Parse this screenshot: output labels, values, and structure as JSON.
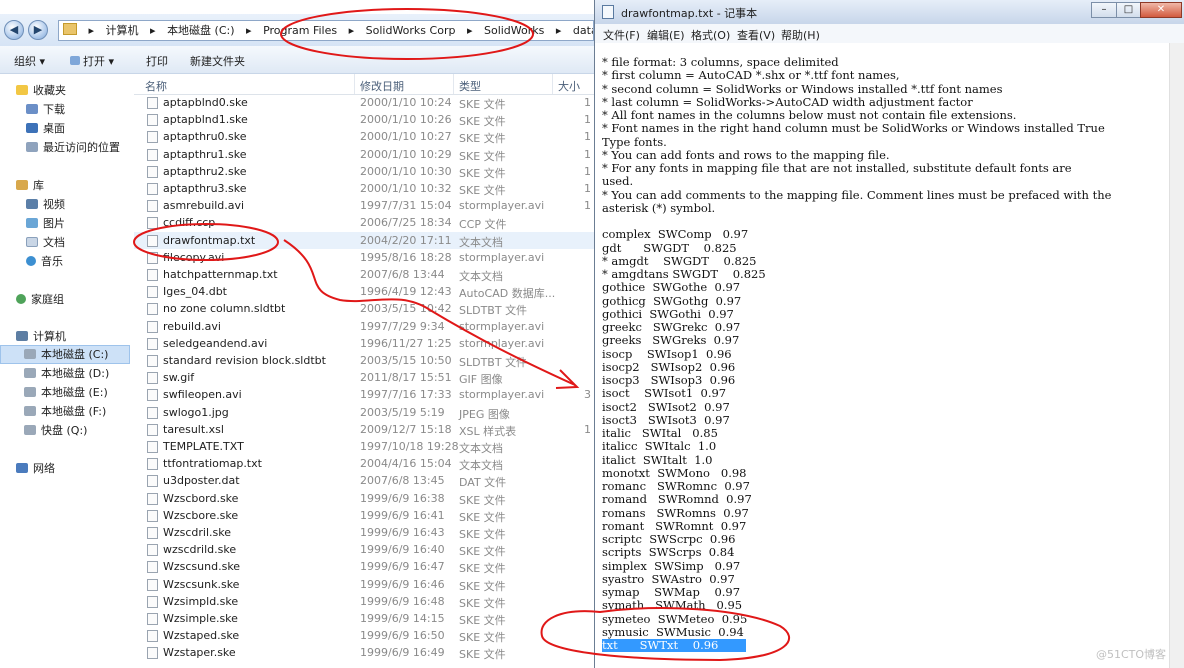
{
  "explorer": {
    "title_bar": {
      "search_placeholder": ""
    },
    "address": {
      "crumbs": [
        "计算机",
        "本地磁盘 (C:)",
        "Program Files",
        "SolidWorks Corp",
        "SolidWorks",
        "data"
      ]
    },
    "toolbar": {
      "organize": "组织 ▾",
      "open": "打开 ▾",
      "print": "打印",
      "new_folder": "新建文件夹"
    },
    "nav": {
      "favorites": "收藏夹",
      "downloads": "下载",
      "desktop": "桌面",
      "recent": "最近访问的位置",
      "libraries": "库",
      "videos": "视频",
      "pictures": "图片",
      "documents": "文档",
      "music": "音乐",
      "homegroup": "家庭组",
      "computer": "计算机",
      "drive_c": "本地磁盘 (C:)",
      "drive_d": "本地磁盘 (D:)",
      "drive_e": "本地磁盘 (E:)",
      "drive_f": "本地磁盘 (F:)",
      "drive_q": "快盘 (Q:)",
      "network": "网络"
    },
    "columns": {
      "name": "名称",
      "date": "修改日期",
      "type": "类型",
      "size": "大小"
    },
    "files": [
      {
        "name": "aptapblnd0.ske",
        "date": "2000/1/10 10:24",
        "type": "SKE 文件",
        "size": "1"
      },
      {
        "name": "aptapblnd1.ske",
        "date": "2000/1/10 10:26",
        "type": "SKE 文件",
        "size": "1"
      },
      {
        "name": "aptapthru0.ske",
        "date": "2000/1/10 10:27",
        "type": "SKE 文件",
        "size": "1"
      },
      {
        "name": "aptapthru1.ske",
        "date": "2000/1/10 10:29",
        "type": "SKE 文件",
        "size": "1"
      },
      {
        "name": "aptapthru2.ske",
        "date": "2000/1/10 10:30",
        "type": "SKE 文件",
        "size": "1"
      },
      {
        "name": "aptapthru3.ske",
        "date": "2000/1/10 10:32",
        "type": "SKE 文件",
        "size": "1"
      },
      {
        "name": "asmrebuild.avi",
        "date": "1997/7/31 15:04",
        "type": "stormplayer.avi",
        "size": "1"
      },
      {
        "name": "ccdiff.ccp",
        "date": "2006/7/25 18:34",
        "type": "CCP 文件",
        "size": ""
      },
      {
        "name": "drawfontmap.txt",
        "date": "2004/2/20 17:11",
        "type": "文本文档",
        "size": ""
      },
      {
        "name": "filecopy.avi",
        "date": "1995/8/16 18:28",
        "type": "stormplayer.avi",
        "size": ""
      },
      {
        "name": "hatchpatternmap.txt",
        "date": "2007/6/8 13:44",
        "type": "文本文档",
        "size": ""
      },
      {
        "name": "Iges_04.dbt",
        "date": "1996/4/19 12:43",
        "type": "AutoCAD 数据库...",
        "size": ""
      },
      {
        "name": "no zone column.sldtbt",
        "date": "2003/5/15 10:42",
        "type": "SLDTBT 文件",
        "size": ""
      },
      {
        "name": "rebuild.avi",
        "date": "1997/7/29 9:34",
        "type": "stormplayer.avi",
        "size": ""
      },
      {
        "name": "seledgeandend.avi",
        "date": "1996/11/27 1:25",
        "type": "stormplayer.avi",
        "size": ""
      },
      {
        "name": "standard revision block.sldtbt",
        "date": "2003/5/15 10:50",
        "type": "SLDTBT 文件",
        "size": ""
      },
      {
        "name": "sw.gif",
        "date": "2011/8/17 15:51",
        "type": "GIF 图像",
        "size": ""
      },
      {
        "name": "swfileopen.avi",
        "date": "1997/7/16 17:33",
        "type": "stormplayer.avi",
        "size": "3"
      },
      {
        "name": "swlogo1.jpg",
        "date": "2003/5/19 5:19",
        "type": "JPEG 图像",
        "size": ""
      },
      {
        "name": "taresult.xsl",
        "date": "2009/12/7 15:18",
        "type": "XSL 样式表",
        "size": "1"
      },
      {
        "name": "TEMPLATE.TXT",
        "date": "1997/10/18 19:28",
        "type": "文本文档",
        "size": ""
      },
      {
        "name": "ttfontratiomap.txt",
        "date": "2004/4/16 15:04",
        "type": "文本文档",
        "size": ""
      },
      {
        "name": "u3dposter.dat",
        "date": "2007/6/8 13:45",
        "type": "DAT 文件",
        "size": ""
      },
      {
        "name": "Wzscbord.ske",
        "date": "1999/6/9 16:38",
        "type": "SKE 文件",
        "size": ""
      },
      {
        "name": "Wzscbore.ske",
        "date": "1999/6/9 16:41",
        "type": "SKE 文件",
        "size": ""
      },
      {
        "name": "Wzscdril.ske",
        "date": "1999/6/9 16:43",
        "type": "SKE 文件",
        "size": ""
      },
      {
        "name": "wzscdrild.ske",
        "date": "1999/6/9 16:40",
        "type": "SKE 文件",
        "size": ""
      },
      {
        "name": "Wzscsund.ske",
        "date": "1999/6/9 16:47",
        "type": "SKE 文件",
        "size": ""
      },
      {
        "name": "Wzscsunk.ske",
        "date": "1999/6/9 16:46",
        "type": "SKE 文件",
        "size": ""
      },
      {
        "name": "Wzsimpld.ske",
        "date": "1999/6/9 16:48",
        "type": "SKE 文件",
        "size": ""
      },
      {
        "name": "Wzsimple.ske",
        "date": "1999/6/9 14:15",
        "type": "SKE 文件",
        "size": ""
      },
      {
        "name": "Wzstaped.ske",
        "date": "1999/6/9 16:50",
        "type": "SKE 文件",
        "size": ""
      },
      {
        "name": "Wzstaper.ske",
        "date": "1999/6/9 16:49",
        "type": "SKE 文件",
        "size": ""
      }
    ]
  },
  "notepad": {
    "title": "drawfontmap.txt - 记事本",
    "menu": [
      "文件(F)",
      "编辑(E)",
      "格式(O)",
      "查看(V)",
      "帮助(H)"
    ],
    "lines": [
      "* file format: 3 columns, space delimited",
      "* first column = AutoCAD *.shx or *.ttf font names,",
      "* second column = SolidWorks or Windows installed *.ttf font names",
      "* last column = SolidWorks->AutoCAD width adjustment factor",
      "* All font names in the columns below must not contain file extensions.",
      "* Font names in the right hand column must be SolidWorks or Windows installed True",
      "Type fonts.",
      "* You can add fonts and rows to the mapping file.",
      "* For any fonts in mapping file that are not installed, substitute default fonts are",
      "used.",
      "* You can add comments to the mapping file. Comment lines must be prefaced with the",
      "asterisk (*) symbol.",
      "",
      "complex  SWComp   0.97",
      "gdt      SWGDT    0.825",
      "* amgdt    SWGDT    0.825",
      "* amgdtans SWGDT    0.825",
      "gothice  SWGothe  0.97",
      "gothicg  SWGothg  0.97",
      "gothici  SWGothi  0.97",
      "greekc   SWGrekc  0.97",
      "greeks   SWGreks  0.97",
      "isocp    SWIsop1  0.96",
      "isocp2   SWIsop2  0.96",
      "isocp3   SWIsop3  0.96",
      "isoct    SWIsot1  0.97",
      "isoct2   SWIsot2  0.97",
      "isoct3   SWIsot3  0.97",
      "italic   SWItal   0.85",
      "italicc  SWItalc  1.0",
      "italict  SWItalt  1.0",
      "monotxt  SWMono   0.98",
      "romanc   SWRomnc  0.97",
      "romand   SWRomnd  0.97",
      "romans   SWRomns  0.97",
      "romant   SWRomnt  0.97",
      "scriptc  SWScrpc  0.96",
      "scripts  SWScrps  0.84",
      "simplex  SWSimp   0.97",
      "syastro  SWAstro  0.97",
      "symap    SWMap    0.97",
      "symath   SWMath   0.95",
      "symeteo  SWMeteo  0.95",
      "symusic  SWMusic  0.94",
      "txt      SWTxt    0.96"
    ]
  },
  "watermark": "@51CTO博客"
}
